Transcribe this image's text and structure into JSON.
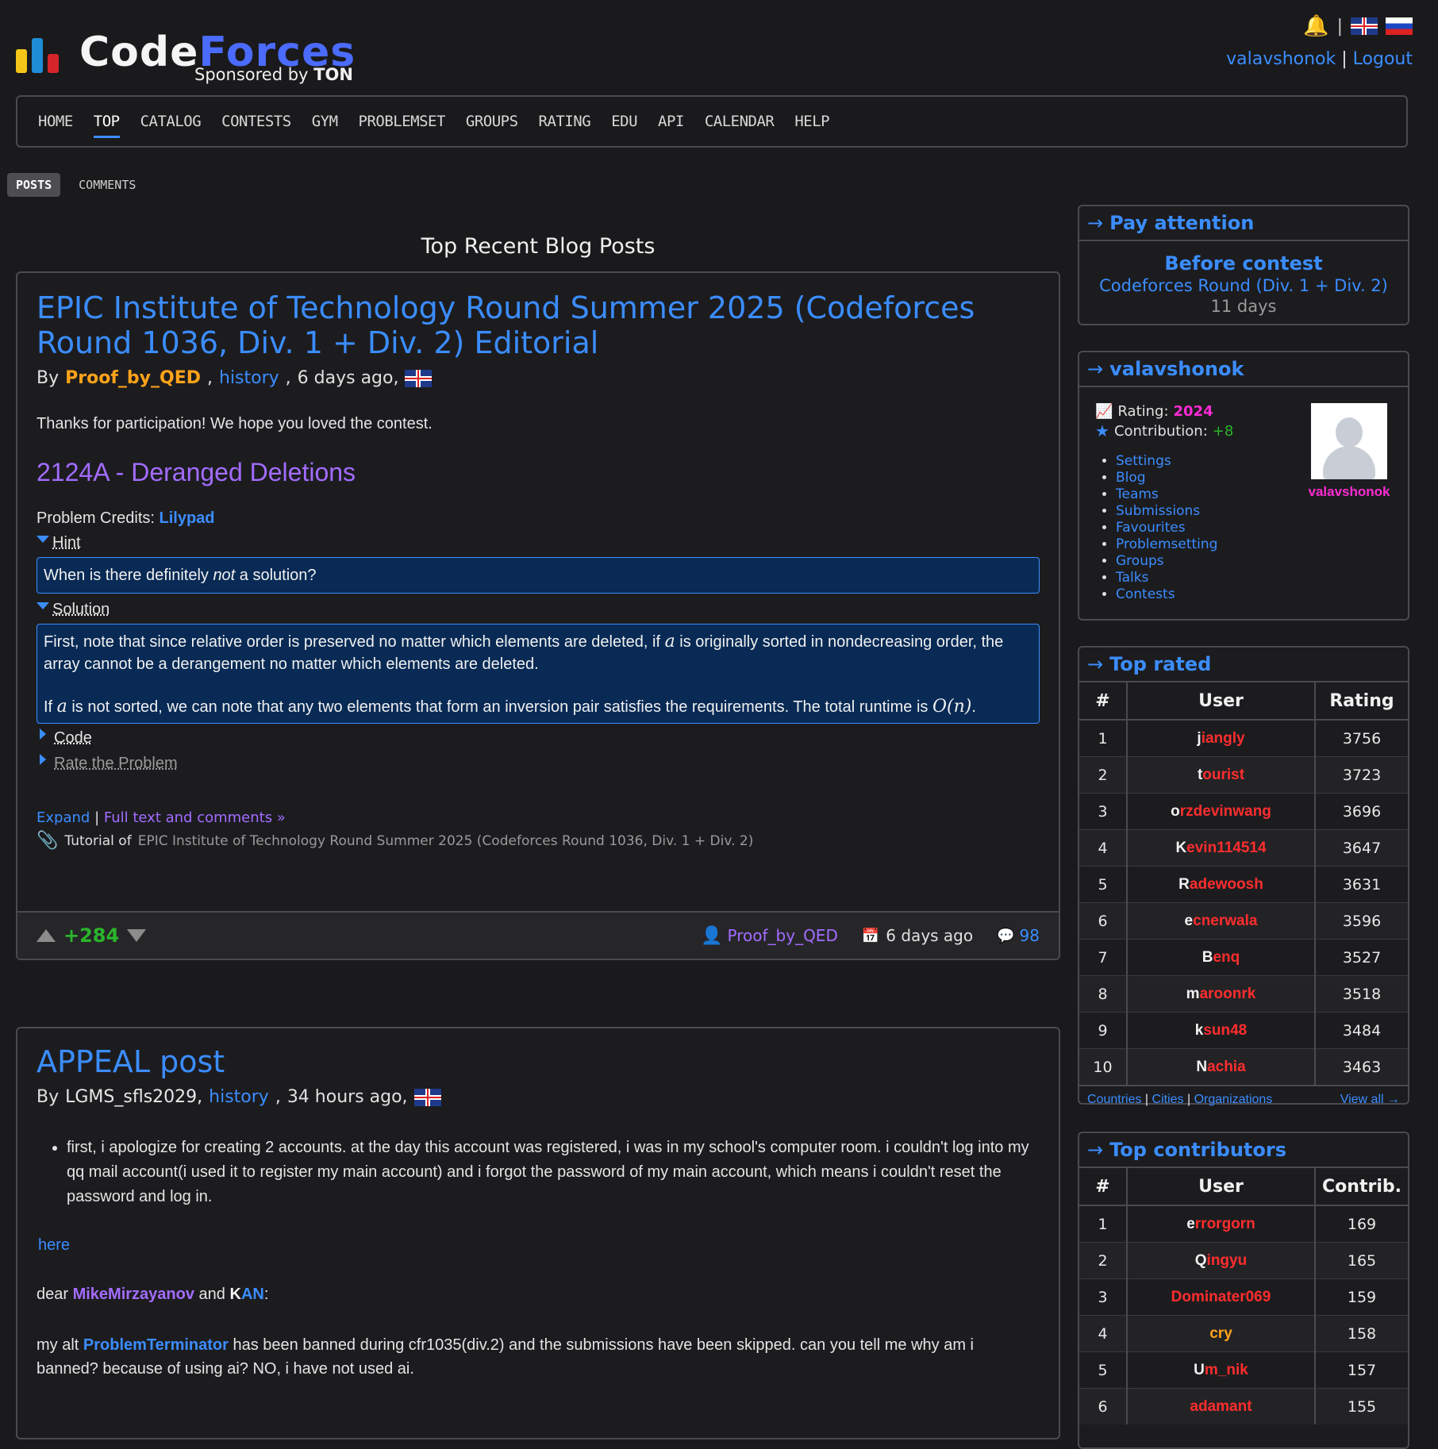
{
  "header": {
    "logo_code": "Code",
    "logo_forces": "Forces",
    "sponsor_prefix": "Sponsored by",
    "sponsor_name": "TON",
    "separator": "|",
    "username": "valavshonok",
    "logout": "Logout"
  },
  "menu": {
    "items": [
      "HOME",
      "TOP",
      "CATALOG",
      "CONTESTS",
      "GYM",
      "PROBLEMSET",
      "GROUPS",
      "RATING",
      "EDU",
      "API",
      "CALENDAR",
      "HELP"
    ],
    "active": "TOP"
  },
  "subtabs": {
    "posts": "POSTS",
    "comments": "COMMENTS"
  },
  "page_heading": "Top Recent Blog Posts",
  "post1": {
    "title": "EPIC Institute of Technology Round Summer 2025 (Codeforces Round 1036, Div. 1 + Div. 2) Editorial",
    "by": "By",
    "author": "Proof_by_QED",
    "history": "history",
    "time": "6 days ago,",
    "intro": "Thanks for participation! We hope you loved the contest.",
    "problem_heading": "2124A - Deranged Deletions",
    "credits_label": "Problem Credits:",
    "credits_user": "Lilypad",
    "hint_label": "Hint",
    "hint_text_a": "When is there definitely ",
    "hint_text_em": "not",
    "hint_text_b": " a solution?",
    "solution_label": "Solution",
    "solution_p1a": "First, note that since relative order is preserved no matter which elements are deleted, if ",
    "solution_var": "a",
    "solution_p1b": " is originally sorted in nondecreasing order, the array cannot be a derangement no matter which elements are deleted.",
    "solution_p2a": "If ",
    "solution_p2b": " is not sorted, we can note that any two elements that form an inversion pair satisfies the requirements. The total runtime is ",
    "solution_complexity": "O(n)",
    "solution_end": ".",
    "code_label": "Code",
    "rate_label": "Rate the Problem",
    "expand": "Expand",
    "full_text": "Full text and comments »",
    "tutorial_of": "Tutorial of",
    "tutorial_link": "EPIC Institute of Technology Round Summer 2025 (Codeforces Round 1036, Div. 1 + Div. 2)",
    "votes": "+284",
    "footer_author": "Proof_by_QED",
    "footer_time": "6 days ago",
    "comments": "98"
  },
  "post2": {
    "title": "APPEAL post",
    "by": "By",
    "author": "LGMS_sfls2029,",
    "history": "history",
    "time": "34 hours ago,",
    "bullet": "first, i apologize for creating 2 accounts. at the day this account was registered, i was in my school's computer room. i couldn't log into my qq mail account(i used it to register my main account) and i forgot the password of my main account, which means i couldn't reset the password and log in.",
    "here": "here",
    "dear": "dear",
    "mention1": "MikeMirzayanov",
    "and": "and",
    "mention2_first": "K",
    "mention2_rest": "AN",
    "colon": ":",
    "p_alt_a": "my alt",
    "alt_user": "ProblemTerminator",
    "p_alt_b": "has been banned during cfr1035(div.2) and the submissions have been skipped. can you tell me why am i banned? because of using ai? NO, i have not used ai."
  },
  "sidebar": {
    "pay_attention": {
      "title": "Pay attention",
      "before": "Before contest",
      "contest": "Codeforces Round (Div. 1 + Div. 2)",
      "days": "11 days"
    },
    "user_box": {
      "title": "valavshonok",
      "rating_label": "Rating:",
      "rating": "2024",
      "contrib_label": "Contribution:",
      "contrib": "+8",
      "links": [
        "Settings",
        "Blog",
        "Teams",
        "Submissions",
        "Favourites",
        "Problemsetting",
        "Groups",
        "Talks",
        "Contests"
      ],
      "avatar_name": "valavshonok"
    },
    "top_rated": {
      "title": "Top rated",
      "headers": [
        "#",
        "User",
        "Rating"
      ],
      "rows": [
        {
          "rank": "1",
          "first": "j",
          "rest": "iangly",
          "value": "3756"
        },
        {
          "rank": "2",
          "first": "t",
          "rest": "ourist",
          "value": "3723"
        },
        {
          "rank": "3",
          "first": "o",
          "rest": "rzdevinwang",
          "value": "3696"
        },
        {
          "rank": "4",
          "first": "K",
          "rest": "evin114514",
          "value": "3647"
        },
        {
          "rank": "5",
          "first": "R",
          "rest": "adewoosh",
          "value": "3631"
        },
        {
          "rank": "6",
          "first": "e",
          "rest": "cnerwala",
          "value": "3596"
        },
        {
          "rank": "7",
          "first": "B",
          "rest": "enq",
          "value": "3527"
        },
        {
          "rank": "8",
          "first": "m",
          "rest": "aroonrk",
          "value": "3518"
        },
        {
          "rank": "9",
          "first": "k",
          "rest": "sun48",
          "value": "3484"
        },
        {
          "rank": "10",
          "first": "N",
          "rest": "achia",
          "value": "3463"
        }
      ],
      "foot_countries": "Countries",
      "foot_cities": "Cities",
      "foot_orgs": "Organizations",
      "view_all": "View all →"
    },
    "top_contrib": {
      "title": "Top contributors",
      "headers": [
        "#",
        "User",
        "Contrib."
      ],
      "rows": [
        {
          "rank": "1",
          "first": "e",
          "rest": "rrorgorn",
          "value": "169",
          "style": "lgm"
        },
        {
          "rank": "2",
          "first": "Q",
          "rest": "ingyu",
          "value": "165",
          "style": "lgm"
        },
        {
          "rank": "3",
          "first": "",
          "rest": "Dominater069",
          "value": "159",
          "style": "red"
        },
        {
          "rank": "4",
          "first": "",
          "rest": "cry",
          "value": "158",
          "style": "orange"
        },
        {
          "rank": "5",
          "first": "U",
          "rest": "m_nik",
          "value": "157",
          "style": "lgm"
        },
        {
          "rank": "6",
          "first": "",
          "rest": "adamant",
          "value": "155",
          "style": "red"
        }
      ]
    }
  }
}
